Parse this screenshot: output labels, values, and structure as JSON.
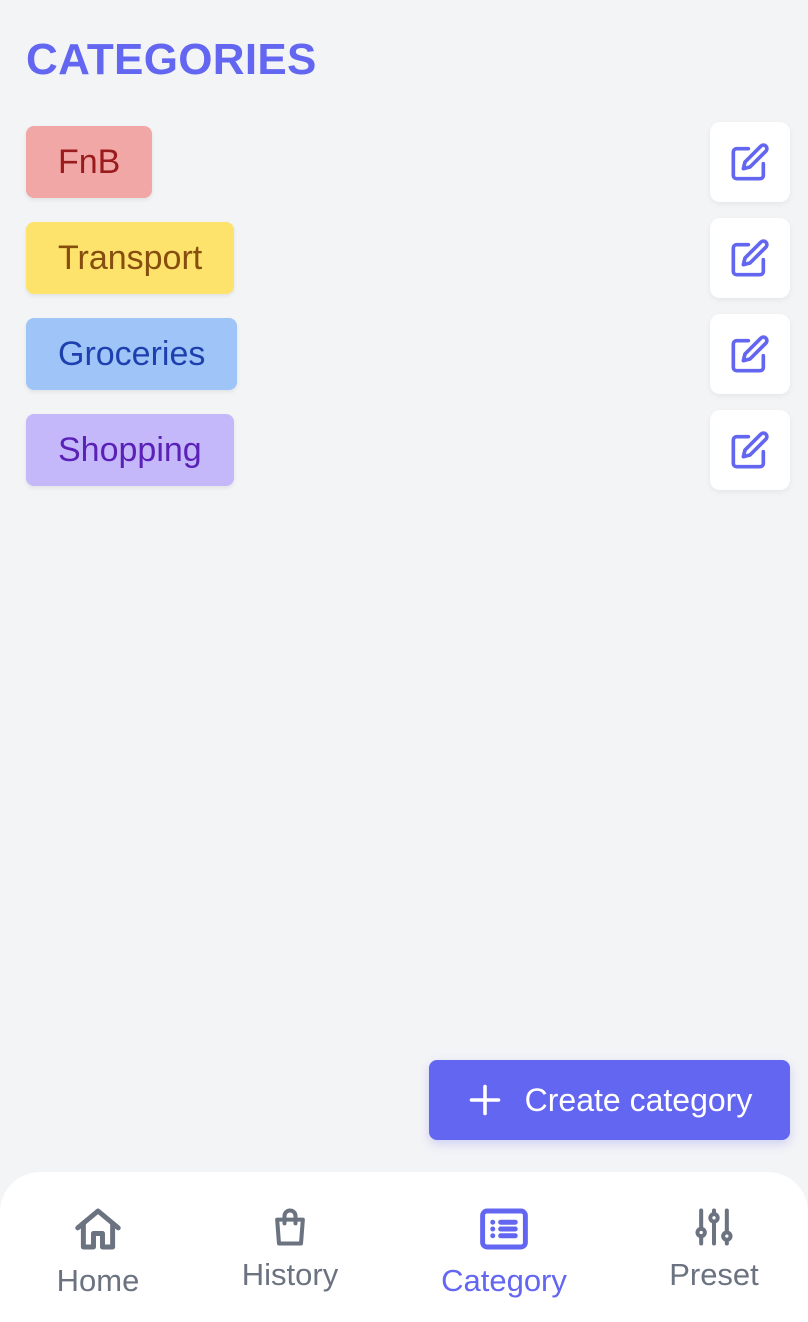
{
  "page": {
    "title": "CATEGORIES"
  },
  "categories": [
    {
      "name": "FnB",
      "bg": "#f2a7a7",
      "fg": "#991b1b"
    },
    {
      "name": "Transport",
      "bg": "#fde26b",
      "fg": "#854d0e"
    },
    {
      "name": "Groceries",
      "bg": "#9fc5f8",
      "fg": "#1e40af"
    },
    {
      "name": "Shopping",
      "bg": "#c4b8fb",
      "fg": "#5b21b6"
    }
  ],
  "actions": {
    "create_label": "Create category"
  },
  "nav": {
    "items": [
      {
        "label": "Home",
        "icon": "home-icon",
        "active": false
      },
      {
        "label": "History",
        "icon": "shopping-bag-icon",
        "active": false
      },
      {
        "label": "Category",
        "icon": "list-icon",
        "active": true
      },
      {
        "label": "Preset",
        "icon": "sliders-icon",
        "active": false
      }
    ]
  },
  "colors": {
    "accent": "#6366f1",
    "background": "#f3f4f6",
    "nav_inactive": "#6b7280"
  }
}
